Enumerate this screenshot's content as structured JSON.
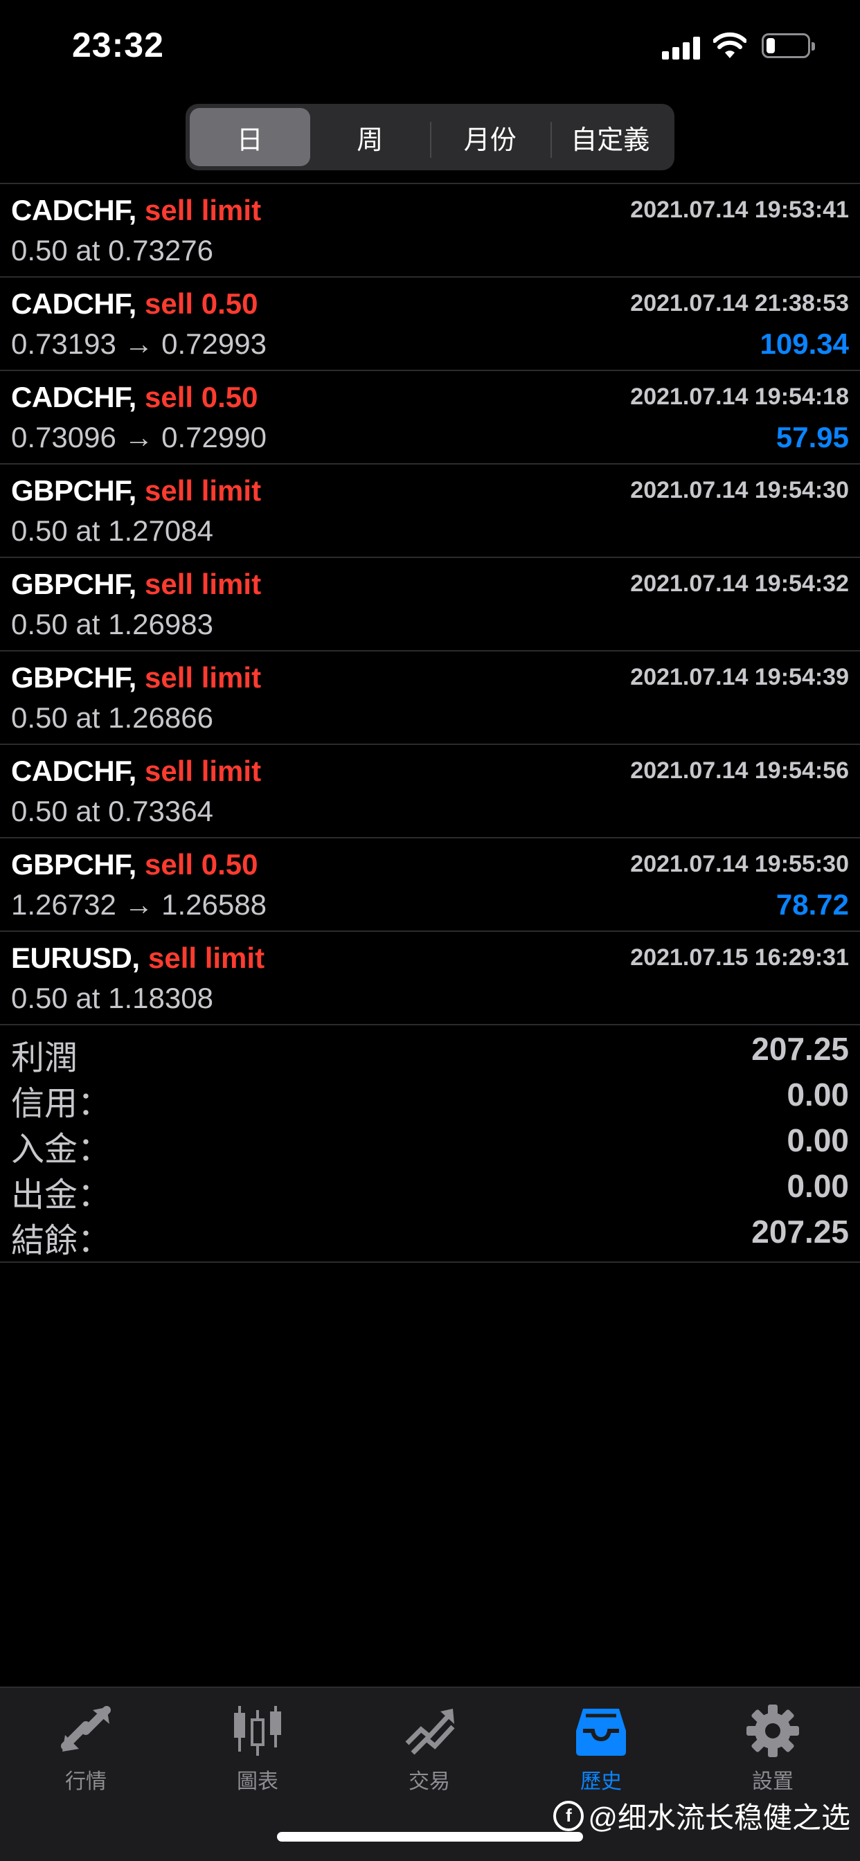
{
  "status_bar": {
    "time": "23:32"
  },
  "period_tabs": [
    {
      "label": "日",
      "active": true
    },
    {
      "label": "周",
      "active": false
    },
    {
      "label": "月份",
      "active": false
    },
    {
      "label": "自定義",
      "active": false
    }
  ],
  "orders": [
    {
      "symbol": "CADCHF,",
      "type": "sell limit",
      "timestamp": "2021.07.14 19:53:41",
      "detail": "0.50 at 0.73276",
      "profit": ""
    },
    {
      "symbol": "CADCHF,",
      "type": "sell 0.50",
      "timestamp": "2021.07.14 21:38:53",
      "detail": "0.73193 → 0.72993",
      "profit": "109.34"
    },
    {
      "symbol": "CADCHF,",
      "type": "sell 0.50",
      "timestamp": "2021.07.14 19:54:18",
      "detail": "0.73096 → 0.72990",
      "profit": "57.95"
    },
    {
      "symbol": "GBPCHF,",
      "type": "sell limit",
      "timestamp": "2021.07.14 19:54:30",
      "detail": "0.50 at 1.27084",
      "profit": ""
    },
    {
      "symbol": "GBPCHF,",
      "type": "sell limit",
      "timestamp": "2021.07.14 19:54:32",
      "detail": "0.50 at 1.26983",
      "profit": ""
    },
    {
      "symbol": "GBPCHF,",
      "type": "sell limit",
      "timestamp": "2021.07.14 19:54:39",
      "detail": "0.50 at 1.26866",
      "profit": ""
    },
    {
      "symbol": "CADCHF,",
      "type": "sell limit",
      "timestamp": "2021.07.14 19:54:56",
      "detail": "0.50 at 0.73364",
      "profit": ""
    },
    {
      "symbol": "GBPCHF,",
      "type": "sell 0.50",
      "timestamp": "2021.07.14 19:55:30",
      "detail": "1.26732 → 1.26588",
      "profit": "78.72"
    },
    {
      "symbol": "EURUSD,",
      "type": "sell limit",
      "timestamp": "2021.07.15 16:29:31",
      "detail": "0.50 at 1.18308",
      "profit": ""
    }
  ],
  "summary": [
    {
      "label": "利潤",
      "value": "207.25"
    },
    {
      "label": "信用：",
      "value": "0.00"
    },
    {
      "label": "入金：",
      "value": "0.00"
    },
    {
      "label": "出金：",
      "value": "0.00"
    },
    {
      "label": "結餘：",
      "value": "207.25"
    }
  ],
  "tab_bar": [
    {
      "label": "行情",
      "icon": "quotes-icon",
      "active": false
    },
    {
      "label": "圖表",
      "icon": "chart-candles-icon",
      "active": false
    },
    {
      "label": "交易",
      "icon": "trade-icon",
      "active": false
    },
    {
      "label": "歷史",
      "icon": "history-inbox-icon",
      "active": true
    },
    {
      "label": "設置",
      "icon": "gear-icon",
      "active": false
    }
  ],
  "watermark": {
    "text": "@细水流长稳健之选"
  },
  "colors": {
    "sell": "#ff3b30",
    "profit": "#0a84ff",
    "active_tab": "#0a84ff"
  }
}
